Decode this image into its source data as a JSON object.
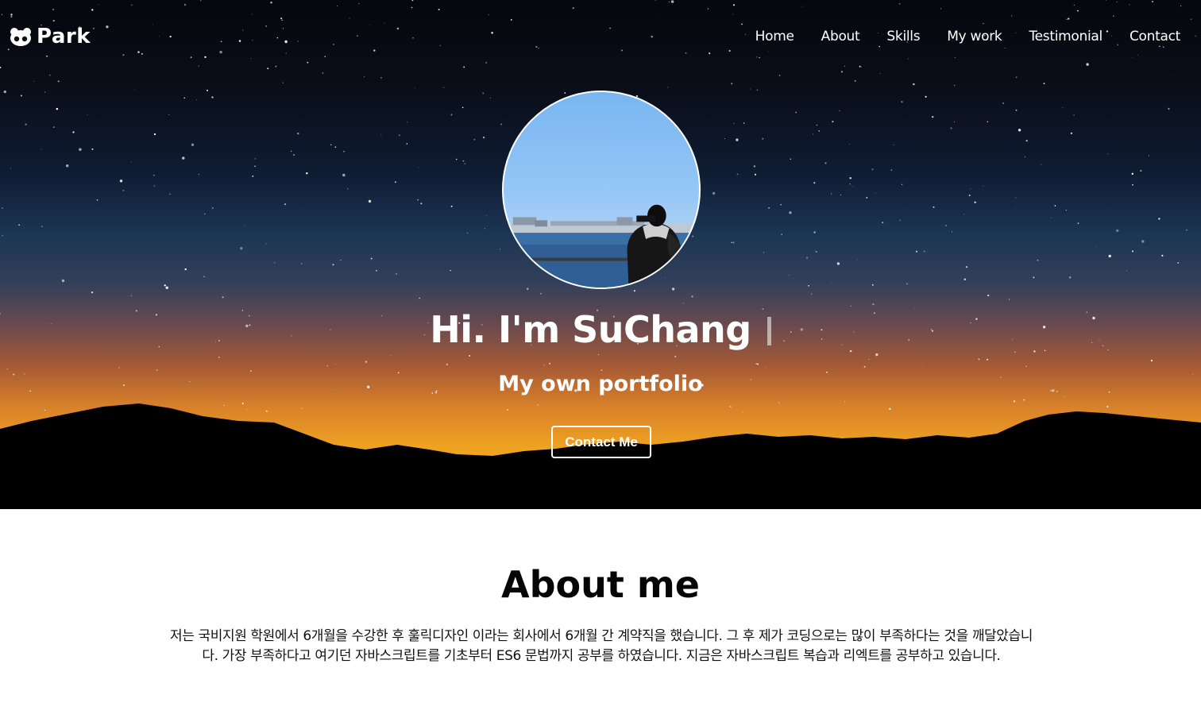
{
  "brand": {
    "name": "Park",
    "icon": "bear-icon"
  },
  "nav": {
    "items": [
      {
        "label": "Home"
      },
      {
        "label": "About"
      },
      {
        "label": "Skills"
      },
      {
        "label": "My work"
      },
      {
        "label": "Testimonial"
      },
      {
        "label": "Contact"
      }
    ]
  },
  "hero": {
    "title": "Hi. I'm SuChang",
    "subtitle": "My own portfolio",
    "cta_label": "Contact Me"
  },
  "about": {
    "title": "About me",
    "body": "저는 국비지원 학원에서 6개월을 수강한 후 훌릭디자인 이라는 회사에서 6개월 간 계약직을 했습니다. 그 후 제가 코딩으로는 많이 부족하다는 것을 깨달았습니다. 가장 부족하다고 여기던 자바스크립트를 기초부터 ES6 문법까지 공부를 하였습니다. 지금은 자바스크립트 복습과 리엑트를 공부하고 있습니다."
  },
  "colors": {
    "text_light": "#ffffff",
    "text_dark": "#050505",
    "sky_top": "#06070c",
    "horizon_orange": "#eea321"
  }
}
